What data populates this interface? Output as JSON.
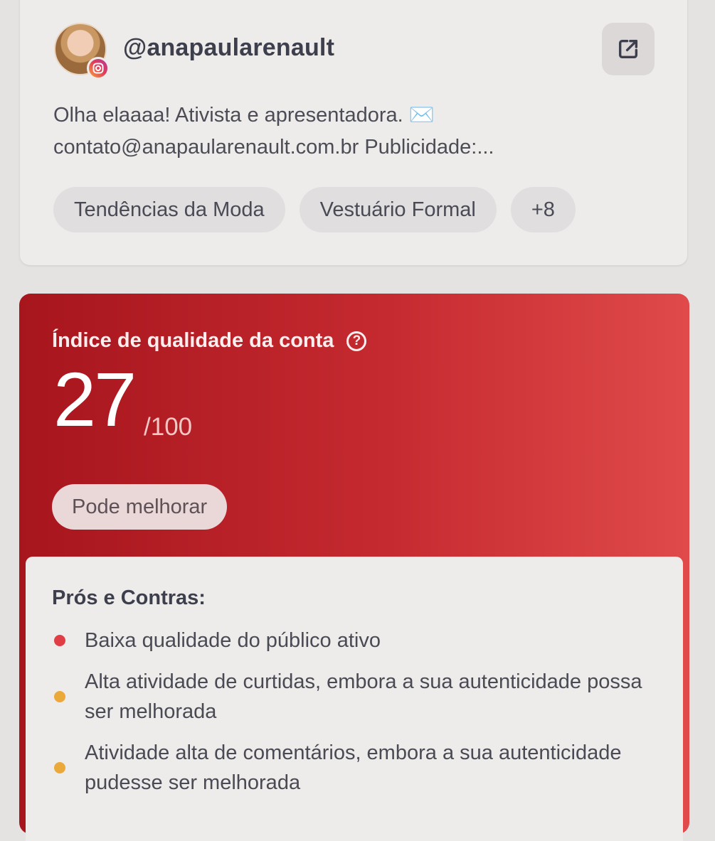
{
  "profile": {
    "handle": "@anapaularenault",
    "avatar_icon": "avatar-photo",
    "network_icon": "instagram-icon",
    "external_link_icon": "external-link-icon",
    "bio_line1": "Olha elaaaa! Ativista e apresentadora. ✉️",
    "bio_line2": "contato@anapaularenault.com.br Publicidade:...",
    "tags": [
      "Tendências da Moda",
      "Vestuário Formal",
      "+8"
    ]
  },
  "quality": {
    "title": "Índice de qualidade da conta",
    "help_icon": "?",
    "score": "27",
    "score_max": "/100",
    "status": "Pode melhorar",
    "colors": {
      "gradient_start": "#a7151d",
      "gradient_end": "#e04a4a"
    }
  },
  "pros_contras": {
    "title": "Prós e Contras:",
    "items": [
      {
        "text": "Baixa qualidade do público ativo",
        "color": "#e03e44"
      },
      {
        "text": "Alta atividade de curtidas, embora a sua autenticidade possa ser melhorada",
        "color": "#eaa93a"
      },
      {
        "text": "Atividade alta de comentários, embora a sua autenticidade pudesse ser melhorada",
        "color": "#eaa93a"
      }
    ]
  }
}
